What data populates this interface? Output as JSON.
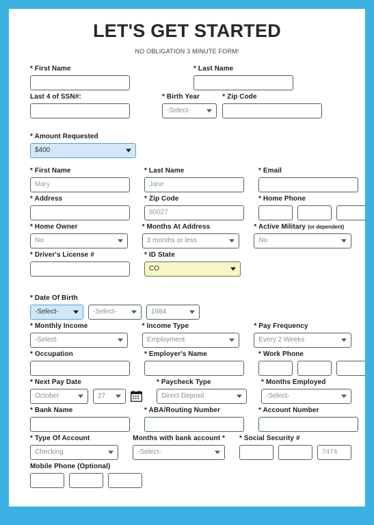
{
  "header": {
    "title": "LET'S GET STARTED",
    "subtitle": "NO OBLIGATION 3 MINUTE FORM!"
  },
  "colors": {
    "frame_blue": "#3BB2E2",
    "card_white": "#FFFFFF",
    "field_border": "#4A6269",
    "highlight_blue_bg": "#CFE9F8",
    "highlight_blue_border": "#5B9EC9",
    "highlight_yellow_bg": "#F7F7C6",
    "highlight_yellow_border": "#6D6D4E",
    "label_text": "#1C1C1C",
    "placeholder_text": "#8D8D8D"
  },
  "form": {
    "top_section": {
      "first_name": {
        "label": "* First Name",
        "value": "",
        "placeholder": ""
      },
      "last_name": {
        "label": "* Last Name",
        "value": "",
        "placeholder": ""
      },
      "ssn_last4": {
        "label": "Last 4 of SSN#:",
        "value": "",
        "placeholder": ""
      },
      "birth_year": {
        "label": "* Birth Year",
        "value": "-Select-"
      },
      "zip_code": {
        "label": "* Zip Code",
        "value": "",
        "placeholder": ""
      }
    },
    "amount_requested": {
      "label": "* Amount Requested",
      "value": "$400"
    },
    "personal": {
      "first_name": {
        "label": "* First Name",
        "value": "",
        "placeholder": "Mary"
      },
      "last_name": {
        "label": "* Last Name",
        "value": "",
        "placeholder": "Jane"
      },
      "email": {
        "label": "* Email",
        "value": "",
        "placeholder": ""
      },
      "address": {
        "label": "* Address",
        "value": "",
        "placeholder": ""
      },
      "zip_code": {
        "label": "* Zip Code",
        "value": "",
        "placeholder": "80027"
      },
      "home_phone": {
        "label": "* Home Phone",
        "parts": [
          "",
          "",
          ""
        ]
      },
      "home_owner": {
        "label": "* Home Owner",
        "value": "No"
      },
      "months_at_address": {
        "label": "* Months At Address",
        "value": "3 months or less"
      },
      "active_military": {
        "label": "* Active Military",
        "label_note": "(or dependent)",
        "value": "No"
      },
      "drivers_license": {
        "label": "* Driver's License #",
        "value": "",
        "placeholder": ""
      },
      "id_state": {
        "label": "* ID State",
        "value": "CO"
      },
      "date_of_birth": {
        "label": "* Date Of Birth",
        "month": "-Select-",
        "day": "-Select-",
        "year": "1984"
      }
    },
    "income": {
      "monthly_income": {
        "label": "* Monthly Income",
        "value": "-Select-"
      },
      "income_type": {
        "label": "* Income Type",
        "value": "Employment"
      },
      "pay_frequency": {
        "label": "* Pay Frequency",
        "value": "Every 2 Weeks"
      },
      "occupation": {
        "label": "* Occupation",
        "value": "",
        "placeholder": ""
      },
      "employer_name": {
        "label": "* Employer's Name",
        "value": "",
        "placeholder": ""
      },
      "work_phone": {
        "label": "* Work Phone",
        "parts": [
          "",
          "",
          ""
        ]
      },
      "next_pay_date": {
        "label": "* Next Pay Date",
        "month": "October",
        "day": "27",
        "icon": "calendar-icon"
      },
      "paycheck_type": {
        "label": "* Paycheck Type",
        "value": "Direct Deposit"
      },
      "months_employed": {
        "label": "* Months Employed",
        "value": "-Select-"
      }
    },
    "banking": {
      "bank_name": {
        "label": "* Bank Name",
        "value": "",
        "placeholder": ""
      },
      "aba_routing": {
        "label": "* ABA/Routing Number",
        "value": "",
        "placeholder": ""
      },
      "account_number": {
        "label": "* Account Number",
        "value": "",
        "placeholder": ""
      },
      "type_of_account": {
        "label": "* Type Of Account",
        "value": "Checking"
      },
      "months_with_bank": {
        "label": "Months with bank account *",
        "value": "-Select-"
      },
      "social_security": {
        "label": "* Social Security #",
        "parts": [
          "",
          "",
          ""
        ],
        "placeholders": [
          "",
          "",
          "7474"
        ]
      },
      "mobile_phone": {
        "label": "Mobile Phone (Optional)",
        "parts": [
          "",
          "",
          ""
        ]
      }
    }
  }
}
